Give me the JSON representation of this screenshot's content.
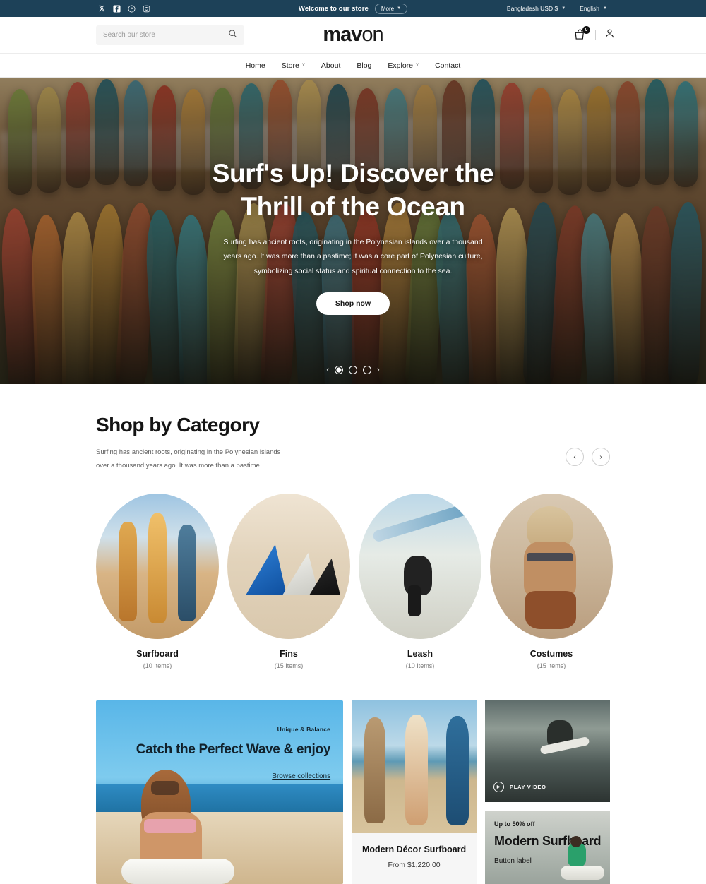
{
  "topbar": {
    "social": [
      {
        "name": "x-twitter-icon",
        "label": "X"
      },
      {
        "name": "facebook-icon",
        "label": "Facebook"
      },
      {
        "name": "pinterest-icon",
        "label": "Pinterest"
      },
      {
        "name": "instagram-icon",
        "label": "Instagram"
      }
    ],
    "welcome": "Welcome to our store",
    "more_label": "More",
    "currency": "Bangladesh USD $",
    "language": "English"
  },
  "header": {
    "search_placeholder": "Search our store",
    "search_value": "",
    "logo_bold": "mav",
    "logo_light": "on",
    "cart_count": "0"
  },
  "nav": {
    "items": [
      {
        "label": "Home",
        "has_dropdown": false
      },
      {
        "label": "Store",
        "has_dropdown": true
      },
      {
        "label": "About",
        "has_dropdown": false
      },
      {
        "label": "Blog",
        "has_dropdown": false
      },
      {
        "label": "Explore",
        "has_dropdown": true
      },
      {
        "label": "Contact",
        "has_dropdown": false
      }
    ]
  },
  "hero": {
    "title": "Surf's Up! Discover the Thrill of the Ocean",
    "paragraph": "Surfing has ancient roots, originating in the Polynesian islands over a thousand years ago. It was more than a pastime; it was a core part of Polynesian culture, symbolizing social status and spiritual connection to the sea.",
    "cta": "Shop now",
    "slide_count": 3,
    "active_slide": 1,
    "prev_label": "‹",
    "next_label": "›"
  },
  "category_section": {
    "title": "Shop by Category",
    "subtitle": "Surfing has ancient roots, originating in the Polynesian islands over a thousand years ago. It was more than a pastime.",
    "prev_label": "‹",
    "next_label": "›",
    "items": [
      {
        "name": "Surfboard",
        "count": "(10 Items)",
        "art": "art-surfboard"
      },
      {
        "name": "Fins",
        "count": "(15 Items)",
        "art": "art-fins"
      },
      {
        "name": "Leash",
        "count": "(10 Items)",
        "art": "art-leash"
      },
      {
        "name": "Costumes",
        "count": "(15 Items)",
        "art": "art-costumes"
      }
    ]
  },
  "promos": {
    "left": {
      "kicker": "Unique & Balance",
      "title": "Catch the Perfect Wave & enjoy",
      "link": "Browse collections"
    },
    "middle": {
      "product_name": "Modern Décor Surfboard",
      "price": "From $1,220.00"
    },
    "video": {
      "label": "PLAY VIDEO"
    },
    "offer": {
      "kicker": "Up to 50% off",
      "title": "Modern Surfboard",
      "button": "Button label"
    }
  },
  "colors": {
    "topbar_bg": "#1d4158",
    "text_dark": "#141414",
    "muted": "#7a7a7a"
  }
}
